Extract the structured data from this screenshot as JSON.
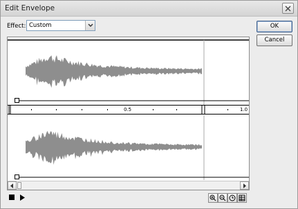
{
  "window": {
    "title": "Edit Envelope"
  },
  "effect": {
    "label": "Effect:",
    "value": "Custom"
  },
  "buttons": {
    "ok": "OK",
    "cancel": "Cancel"
  },
  "ruler": {
    "mid_label": "0.5",
    "end_label": "1.0"
  },
  "icons": {
    "close": "close-icon",
    "dropdown": "chevron-down-icon",
    "stop": "stop-icon",
    "play": "play-icon",
    "zoom_in": "zoom-in-icon",
    "zoom_out": "zoom-out-icon",
    "seconds": "clock-icon",
    "frames": "frames-icon"
  },
  "colors": {
    "waveform": "#8e8e8e",
    "envelope_handle": "#ffffff"
  }
}
